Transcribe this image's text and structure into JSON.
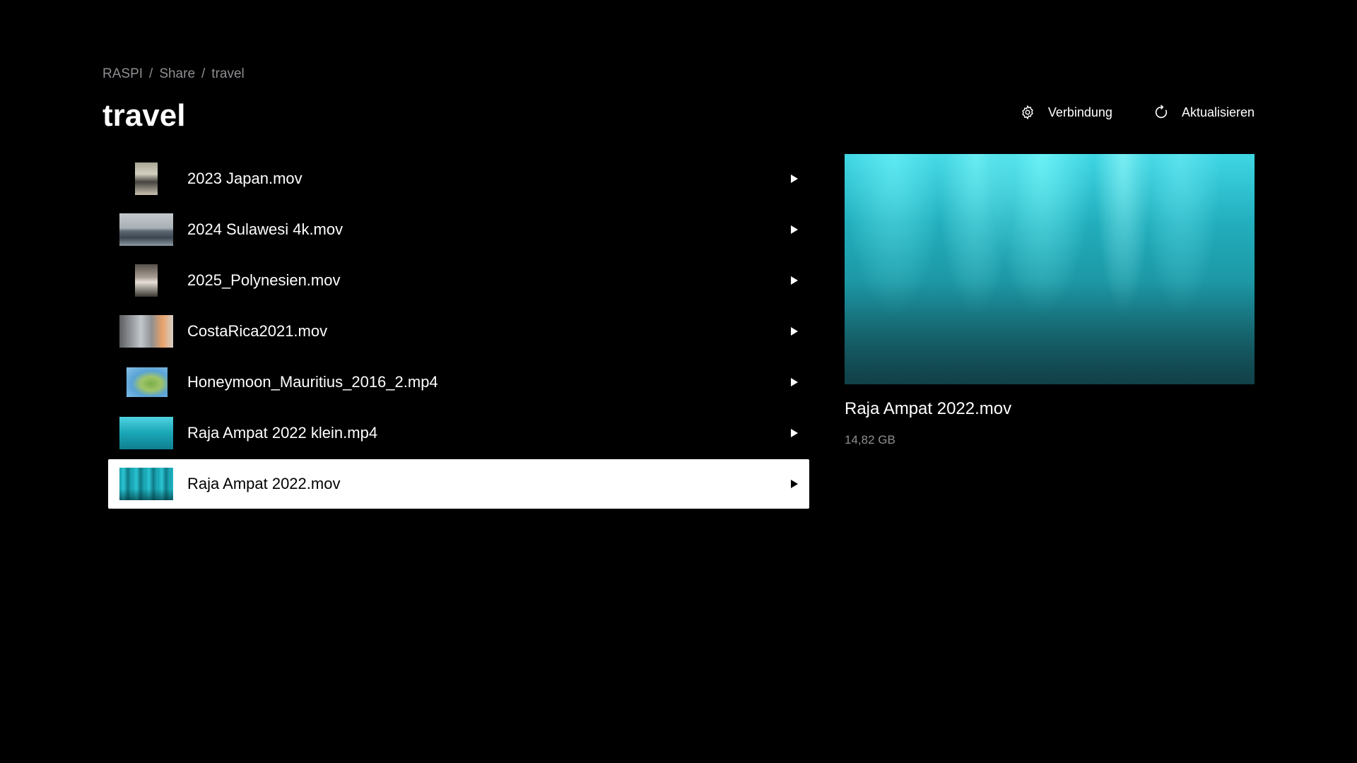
{
  "breadcrumb": {
    "items": [
      "RASPI",
      "Share",
      "travel"
    ],
    "separator": "/"
  },
  "page": {
    "title": "travel"
  },
  "header": {
    "connection": {
      "label": "Verbindung",
      "icon": "gear-icon"
    },
    "refresh": {
      "label": "Aktualisieren",
      "icon": "refresh-icon"
    }
  },
  "files": [
    {
      "name": "2023 Japan.mov",
      "selected": false
    },
    {
      "name": "2024 Sulawesi 4k.mov",
      "selected": false
    },
    {
      "name": "2025_Polynesien.mov",
      "selected": false
    },
    {
      "name": "CostaRica2021.mov",
      "selected": false
    },
    {
      "name": "Honeymoon_Mauritius_2016_2.mp4",
      "selected": false
    },
    {
      "name": "Raja Ampat 2022 klein.mp4",
      "selected": false
    },
    {
      "name": "Raja Ampat 2022.mov",
      "selected": true
    }
  ],
  "preview": {
    "title": "Raja Ampat 2022.mov",
    "size": "14,82 GB"
  },
  "colors": {
    "background": "#000000",
    "selected_row": "#ffffff",
    "secondary_text": "#8e8e93"
  }
}
